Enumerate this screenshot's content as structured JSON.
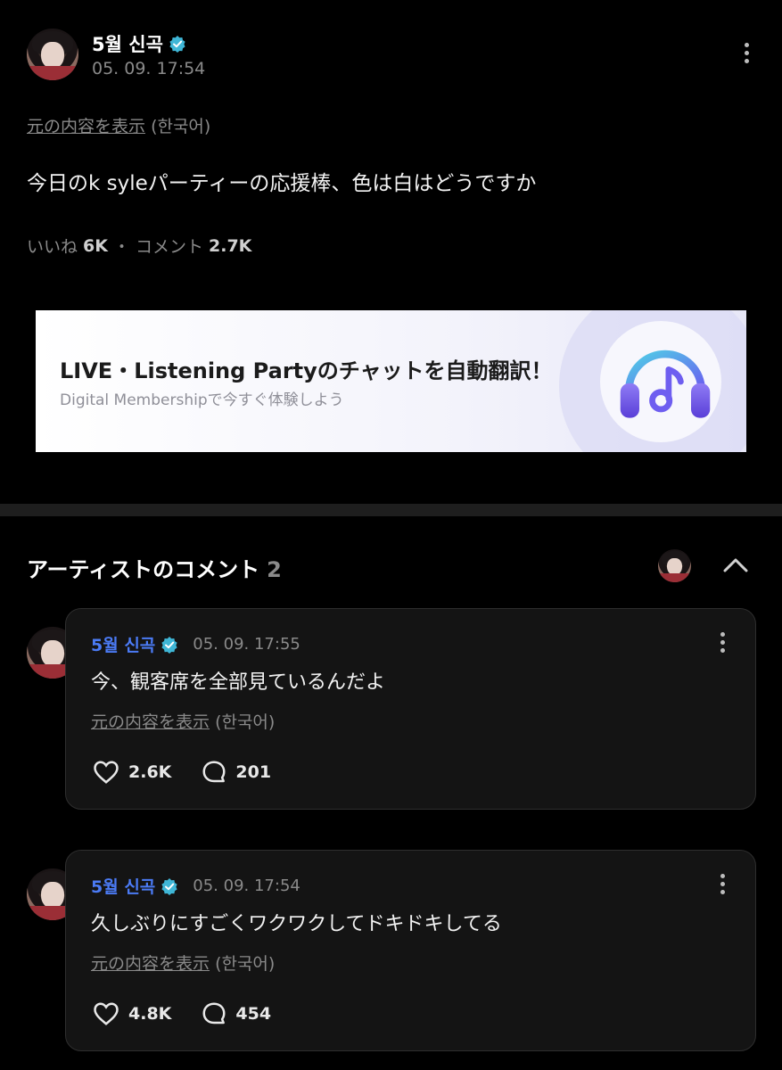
{
  "post": {
    "author": "5월 신곡",
    "timestamp": "05. 09. 17:54",
    "show_original": "元の内容を表示",
    "original_lang": "(한국어)",
    "body": "今日のk syleパーティーの応援棒、色は白はどうですか",
    "likes_label": "いいね",
    "likes_count": "6K",
    "separator": "・",
    "comments_label": "コメント",
    "comments_count": "2.7K"
  },
  "banner": {
    "title": "LIVE・Listening Partyのチャットを自動翻訳！",
    "subtitle": "Digital Membershipで今すぐ体験しよう"
  },
  "artist_comments": {
    "heading": "アーティストのコメント",
    "count": "2",
    "items": [
      {
        "author": "5월 신곡",
        "timestamp": "05. 09. 17:55",
        "body": "今、観客席を全部見ているんだよ",
        "show_original": "元の内容を表示",
        "original_lang": "(한국어)",
        "likes": "2.6K",
        "replies": "201"
      },
      {
        "author": "5월 신곡",
        "timestamp": "05. 09. 17:54",
        "body": "久しぶりにすごくワクワクしてドキドキしてる",
        "show_original": "元の内容を表示",
        "original_lang": "(한국어)",
        "likes": "4.8K",
        "replies": "454"
      }
    ]
  },
  "icons": {
    "verified": "verified-badge-icon",
    "more": "more-vertical-icon",
    "heart": "heart-icon",
    "comment": "comment-bubble-icon",
    "collapse": "chevron-up-icon",
    "headphones": "headphones-music-icon"
  },
  "colors": {
    "background": "#000000",
    "card": "#141414",
    "accent_blue": "#4b7bf5",
    "verified": "#3fb6d6",
    "muted": "#8a8a8a"
  }
}
